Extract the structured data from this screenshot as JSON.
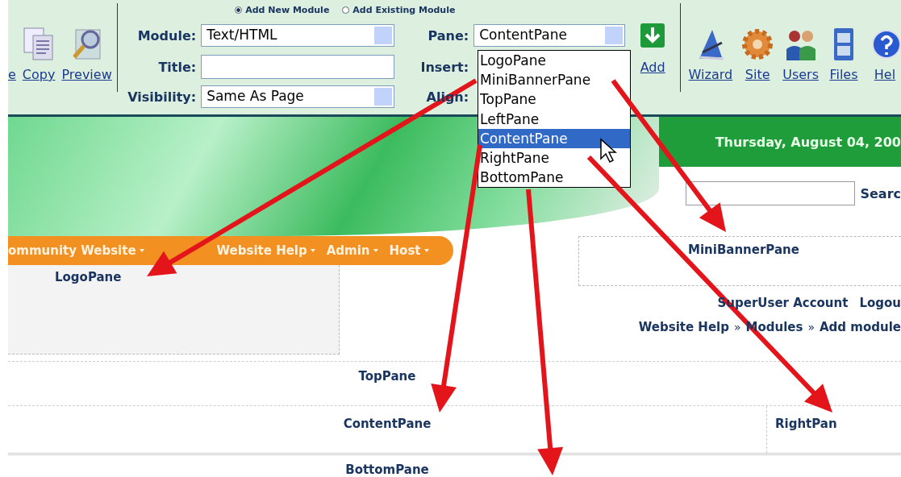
{
  "mode_options": [
    {
      "label": "Add New Module",
      "selected": true
    },
    {
      "label": "Add Existing Module",
      "selected": false
    }
  ],
  "actions": [
    {
      "label": "e",
      "kind": "none"
    },
    {
      "label": "Copy",
      "kind": "copy"
    },
    {
      "label": "Preview",
      "kind": "preview"
    }
  ],
  "form": {
    "module": {
      "label": "Module:",
      "value": "Text/HTML"
    },
    "title": {
      "label": "Title:"
    },
    "visibility": {
      "label": "Visibility:",
      "value": "Same As Page"
    },
    "pane": {
      "label": "Pane:",
      "value": "ContentPane"
    },
    "insert": {
      "label": "Insert:"
    },
    "align": {
      "label": "Align:"
    }
  },
  "pane_options": [
    {
      "label": "LogoPane",
      "selected": false
    },
    {
      "label": "MiniBannerPane",
      "selected": false
    },
    {
      "label": "TopPane",
      "selected": false
    },
    {
      "label": "LeftPane",
      "selected": false
    },
    {
      "label": "ContentPane",
      "selected": true
    },
    {
      "label": "RightPane",
      "selected": false
    },
    {
      "label": "BottomPane",
      "selected": false
    }
  ],
  "add_label": "Add",
  "tools": [
    {
      "label": "Wizard",
      "kind": "wizard"
    },
    {
      "label": "Site",
      "kind": "site"
    },
    {
      "label": "Users",
      "kind": "users"
    },
    {
      "label": "Files",
      "kind": "files"
    },
    {
      "label": "Hel",
      "kind": "help"
    }
  ],
  "date": "Thursday, August 04, 200",
  "search_label": "Searc",
  "menu": [
    "ommunity Website",
    "Website Help",
    "Admin",
    "Host"
  ],
  "panes": {
    "logo": "LogoPane",
    "mini_banner": "MiniBannerPane",
    "top": "TopPane",
    "content": "ContentPane",
    "right": "RightPan",
    "bottom": "BottomPane"
  },
  "user_links": [
    "SuperUser Account",
    "Logou"
  ],
  "breadcrumb": {
    "items": [
      "Website Help",
      "Modules",
      "Add module"
    ],
    "separator": "»"
  }
}
